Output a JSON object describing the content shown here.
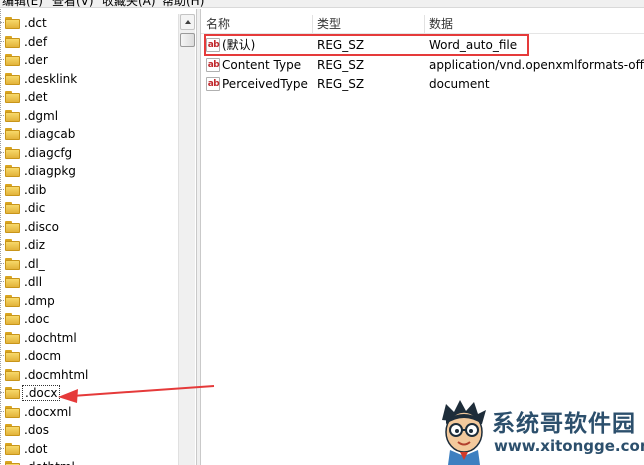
{
  "menu": [
    "编辑(E)",
    "查看(V)",
    "收藏夹(A)",
    "帮助(H)"
  ],
  "tree": {
    "items": [
      ".dct",
      ".def",
      ".der",
      ".desklink",
      ".det",
      ".dgml",
      ".diagcab",
      ".diagcfg",
      ".diagpkg",
      ".dib",
      ".dic",
      ".disco",
      ".diz",
      ".dl_",
      ".dll",
      ".dmp",
      ".doc",
      ".dochtml",
      ".docm",
      ".docmhtml",
      ".docx",
      ".docxml",
      ".dos",
      ".dot",
      ".dothtml"
    ],
    "selected": ".docx"
  },
  "values": {
    "headers": {
      "name": "名称",
      "type": "类型",
      "data": "数据"
    },
    "rows": [
      {
        "icon": "ab",
        "name": "(默认)",
        "type": "REG_SZ",
        "data": "Word_auto_file"
      },
      {
        "icon": "ab",
        "name": "Content Type",
        "type": "REG_SZ",
        "data": "application/vnd.openxmlformats-officed"
      },
      {
        "icon": "ab",
        "name": "PerceivedType",
        "type": "REG_SZ",
        "data": "document"
      }
    ]
  },
  "annotation": {
    "highlight_color": "#e53a3a",
    "arrow_color": "#e53a3a"
  },
  "watermark": {
    "title": "系统哥软件园",
    "url": "www.xitongge.com"
  }
}
